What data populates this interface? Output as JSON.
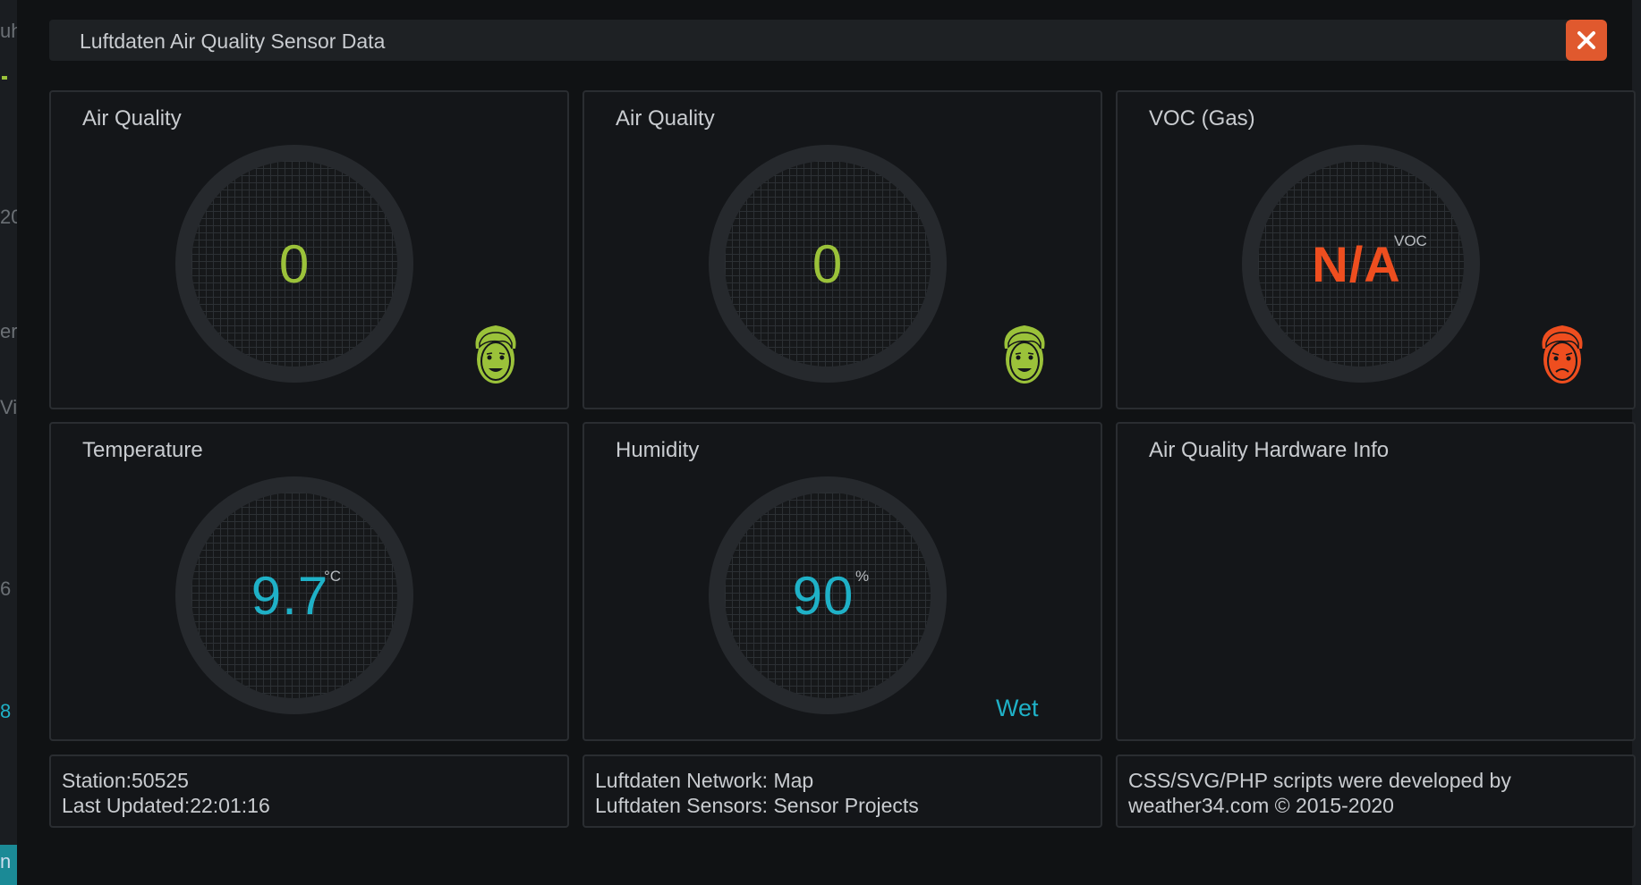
{
  "dialog": {
    "title": "Luftdaten Air Quality Sensor Data",
    "close_icon": "close-icon"
  },
  "colors": {
    "good": "#9bc23a",
    "bad": "#ee4e1f",
    "cyan": "#1fb1c7",
    "close_bg": "#e0592e"
  },
  "cards": [
    {
      "title": "Air Quality",
      "value": "0",
      "unit": "",
      "face": "happy-face-icon"
    },
    {
      "title": "Air Quality",
      "value": "0",
      "unit": "",
      "face": "happy-face-icon"
    },
    {
      "title": "VOC (Gas)",
      "value": "N/A",
      "unit": "VOC",
      "face": "sad-face-icon"
    },
    {
      "title": "Temperature",
      "value": "9.7",
      "unit": "°C"
    },
    {
      "title": "Humidity",
      "value": "90",
      "unit": "%",
      "status": "Wet"
    },
    {
      "title": "Air Quality Hardware Info"
    }
  ],
  "footer": {
    "station": "Station:50525",
    "last_updated": "Last Updated:22:01:16",
    "network": "Luftdaten Network: Map",
    "sensors": "Luftdaten Sensors: Sensor Projects",
    "credits_line1": "CSS/SVG/PHP scripts were developed by",
    "credits_line2": "weather34.com © 2015-2020"
  },
  "background_page": {
    "fragments": [
      "uh",
      "20",
      "er",
      "Vir",
      "6",
      "8",
      "n"
    ]
  }
}
